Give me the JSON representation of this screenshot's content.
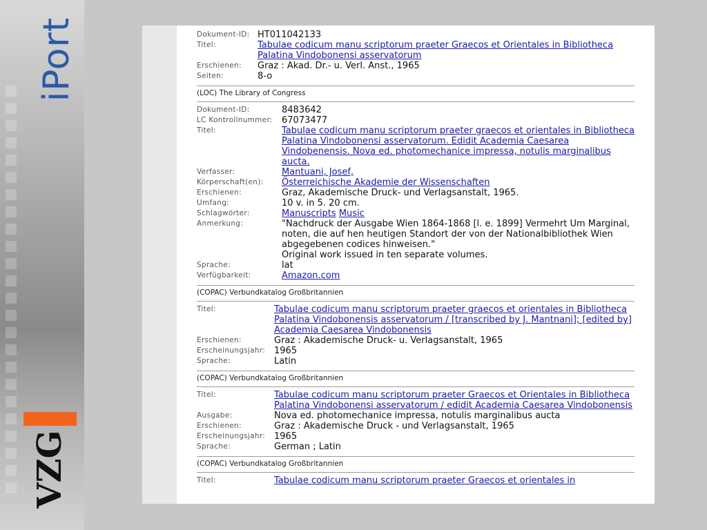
{
  "brand": {
    "product": "iPort",
    "org": "VZG"
  },
  "records": [
    {
      "fields": [
        {
          "label": "Dokument-ID:",
          "value": "HT011042133"
        },
        {
          "label": "Titel:",
          "value": "Tabulae codicum manu scriptorum praeter Graecos et Orientales in Bibliotheca Palatina Vindobonensi asservatorum",
          "link": true
        },
        {
          "label": "Erschienen:",
          "value": "Graz : Akad. Dr.- u. Verl. Anst., 1965"
        },
        {
          "label": "Seiten:",
          "value": "8-o"
        }
      ]
    },
    {
      "source": "(LOC) The Library of Congress",
      "fields": [
        {
          "label": "Dokument-ID:",
          "value": "8483642"
        },
        {
          "label": "LC Kontrollnummer:",
          "value": "67073477"
        },
        {
          "label": "Titel:",
          "value": "Tabulae codicum manu scriptorum praeter graecos et orientales in Bibliotheca Palatina Vindobonensi asservatorum. Edidit Academia Caesarea Vindobenensis. Nova ed. photomechanice impressa, notulis marginalibus aucta.",
          "link": true
        },
        {
          "label": "Verfasser:",
          "value": "Mantuani, Josef,",
          "link": true
        },
        {
          "label": "Körperschaft(en):",
          "value": "Österreichische Akademie der Wissenschaften",
          "link": true
        },
        {
          "label": "Erschienen:",
          "value": "Graz, Akademische Druck- und Verlagsanstalt, 1965."
        },
        {
          "label": "Umfang:",
          "value": "10 v. in 5. 20 cm."
        },
        {
          "label": "Schlagwörter:",
          "links": [
            "Manuscripts",
            "Music"
          ]
        },
        {
          "label": "Anmerkung:",
          "value": "\"Nachdruck der Ausgabe Wien 1864-1868 [l. e. 1899] Vermehrt Um Marginal, noten, die auf hen heutigen Standort der von der Nationalbibliothek Wien abgegebenen codices hinweisen.\"",
          "value2": "Original work issued in ten separate volumes."
        },
        {
          "label": "Sprache:",
          "value": "lat"
        },
        {
          "label": "Verfügbarkeit:",
          "value": "Amazon.com",
          "link": true
        }
      ]
    },
    {
      "source": "(COPAC) Verbundkatalog Großbritannien",
      "fields": [
        {
          "label": "Titel:",
          "value": "Tabulae codicum manu scriptorum praeter graecos et orientales in Bibliotheca Palatina Vindobonensis asservatorum / [transcribed by J. Mantnani]; [edited by] Academia Caesarea Vindobonensis",
          "link": true
        },
        {
          "label": "Erschienen:",
          "value": "Graz : Akademische Druck- u. Verlagsanstalt, 1965"
        },
        {
          "label": "Erscheinungsjahr:",
          "value": "1965"
        },
        {
          "label": "Sprache:",
          "value": "Latin"
        }
      ]
    },
    {
      "source": "(COPAC) Verbundkatalog Großbritannien",
      "fields": [
        {
          "label": "Titel:",
          "value": "Tabulae codicum manu scriptorum praeter Graecos et Orientales in Bibliotheca Palatina Vindobonensi asservatorum / edidit Academia Caesarea Vindobonensis",
          "link": true
        },
        {
          "label": "Ausgabe:",
          "value": "Nova ed. photomechanice impressa, notulis marginalibus aucta"
        },
        {
          "label": "Erschienen:",
          "value": "Graz : Akademische Druck - und Verlagsanstalt, 1965"
        },
        {
          "label": "Erscheinungsjahr:",
          "value": "1965"
        },
        {
          "label": "Sprache:",
          "value": "German ; Latin"
        }
      ]
    },
    {
      "source": "(COPAC) Verbundkatalog Großbritannien",
      "fields": [
        {
          "label": "Titel:",
          "value": "Tabulae codicum manu scriptorum praeter Graecos et orientales in",
          "link": true
        }
      ]
    }
  ]
}
